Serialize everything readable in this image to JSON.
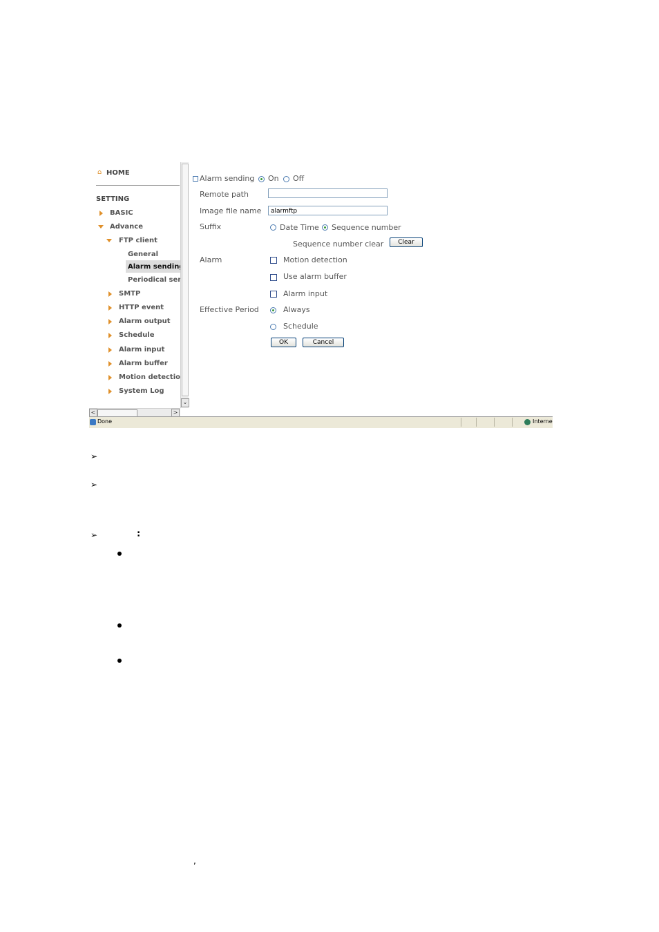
{
  "sidebar": {
    "home": "HOME",
    "setting": "SETTING",
    "basic": "BASIC",
    "advance": "Advance",
    "ftp_client": "FTP client",
    "general": "General",
    "alarm_sending": "Alarm sending",
    "periodical_sending": "Periodical send",
    "smtp": "SMTP",
    "http_event": "HTTP event",
    "alarm_output": "Alarm output",
    "schedule": "Schedule",
    "alarm_input": "Alarm input",
    "alarm_buffer": "Alarm buffer",
    "motion_detection": "Motion detection",
    "system_log": "System Log"
  },
  "form": {
    "alarm_sending_label": "Alarm sending",
    "on": "On",
    "off": "Off",
    "remote_path_label": "Remote path",
    "remote_path_value": "",
    "image_file_name_label": "Image file name",
    "image_file_name_value": "alarmftp",
    "suffix_label": "Suffix",
    "date_time": "Date Time",
    "sequence_number": "Sequence number",
    "sequence_clear_label": "Sequence number clear",
    "clear_button": "Clear",
    "alarm_label": "Alarm",
    "motion_detection": "Motion detection",
    "use_alarm_buffer": "Use alarm buffer",
    "alarm_input": "Alarm input",
    "effective_period_label": "Effective Period",
    "always": "Always",
    "schedule": "Schedule",
    "ok_button": "OK",
    "cancel_button": "Cancel"
  },
  "statusbar": {
    "left": "Done",
    "right": "Internet"
  },
  "doc": {
    "colon": ":",
    "comma": ","
  }
}
